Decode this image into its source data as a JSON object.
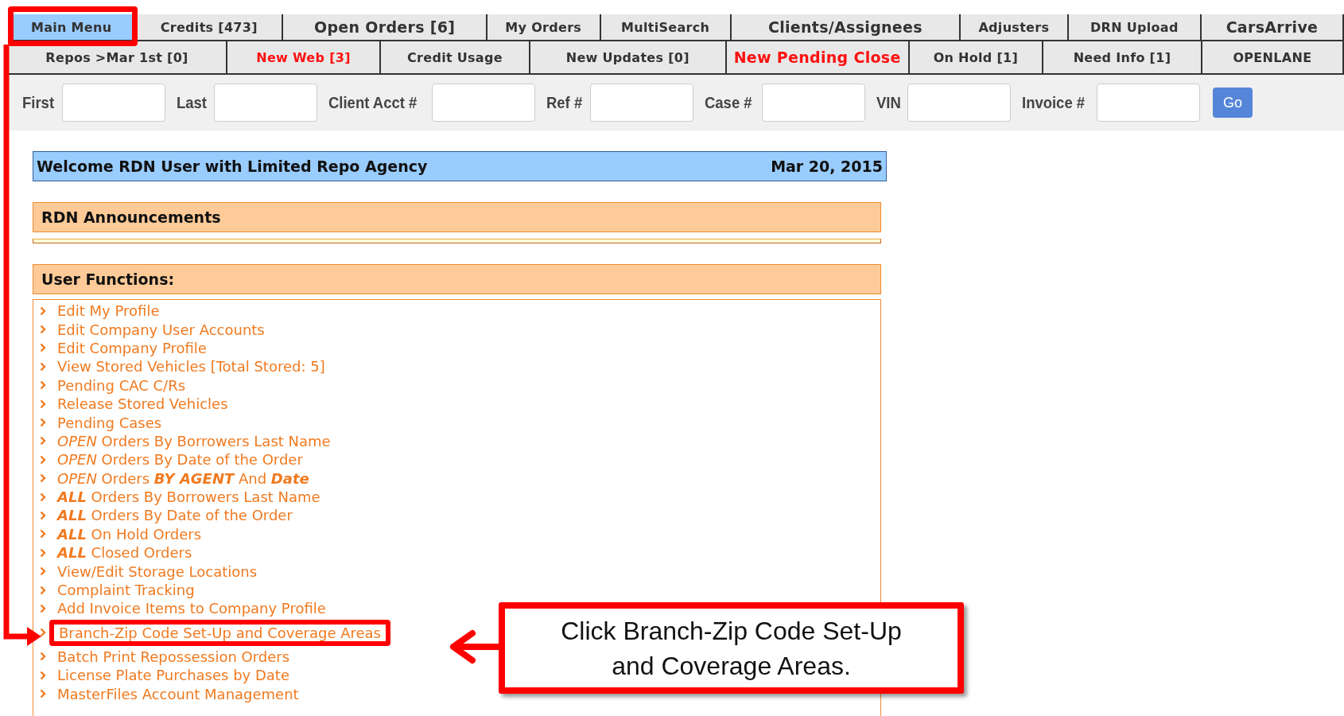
{
  "tabs_row_1": [
    {
      "label": "Main Menu",
      "selected": true,
      "alert": false,
      "large": false
    },
    {
      "label": "Credits [473]",
      "selected": false,
      "alert": false,
      "large": false
    },
    {
      "label": "Open Orders [6]",
      "selected": false,
      "alert": false,
      "large": true
    },
    {
      "label": "My Orders",
      "selected": false,
      "alert": false,
      "large": false
    },
    {
      "label": "MultiSearch",
      "selected": false,
      "alert": false,
      "large": false
    },
    {
      "label": "Clients/Assignees",
      "selected": false,
      "alert": false,
      "large": true
    },
    {
      "label": "Adjusters",
      "selected": false,
      "alert": false,
      "large": false
    },
    {
      "label": "DRN Upload",
      "selected": false,
      "alert": false,
      "large": false
    },
    {
      "label": "CarsArrive",
      "selected": false,
      "alert": false,
      "large": true
    }
  ],
  "tabs_row_2": [
    {
      "label": "Repos >Mar 1st [0]",
      "selected": false,
      "alert": false,
      "large": false
    },
    {
      "label": "New Web [3]",
      "selected": false,
      "alert": true,
      "large": false
    },
    {
      "label": "Credit Usage",
      "selected": false,
      "alert": false,
      "large": false
    },
    {
      "label": "New Updates [0]",
      "selected": false,
      "alert": false,
      "large": false
    },
    {
      "label": "New Pending Close",
      "selected": false,
      "alert": true,
      "large": true
    },
    {
      "label": "On Hold [1]",
      "selected": false,
      "alert": false,
      "large": false
    },
    {
      "label": "Need Info [1]",
      "selected": false,
      "alert": false,
      "large": false
    },
    {
      "label": "OPENLANE",
      "selected": false,
      "alert": false,
      "large": false
    }
  ],
  "search": {
    "fields": [
      "First",
      "Last",
      "Client Acct #",
      "Ref #",
      "Case #",
      "VIN",
      "Invoice #"
    ],
    "button": "Go"
  },
  "welcome": {
    "text": "Welcome RDN User with Limited Repo Agency",
    "date": "Mar 20, 2015"
  },
  "announcements": {
    "title": "RDN Announcements"
  },
  "user_functions": {
    "title": "User Functions:",
    "items": [
      {
        "text": "Edit My Profile",
        "highlighted": false
      },
      {
        "text": "Edit Company User Accounts",
        "highlighted": false
      },
      {
        "text": "Edit Company Profile",
        "highlighted": false
      },
      {
        "text": "View Stored Vehicles [Total Stored: 5]",
        "highlighted": false
      },
      {
        "text": "Pending CAC C/Rs",
        "highlighted": false
      },
      {
        "text": "Release Stored Vehicles",
        "highlighted": false
      },
      {
        "text": "Pending Cases",
        "highlighted": false
      },
      {
        "text": "*OPEN* Orders By Borrowers Last Name",
        "highlighted": false
      },
      {
        "text": "*OPEN* Orders By Date of the Order",
        "highlighted": false
      },
      {
        "text": "*OPEN* Orders **BY AGENT** And **Date**",
        "highlighted": false
      },
      {
        "text": "**ALL** Orders By Borrowers Last Name",
        "highlighted": false
      },
      {
        "text": "**ALL** Orders By Date of the Order",
        "highlighted": false
      },
      {
        "text": "**ALL** On Hold Orders",
        "highlighted": false
      },
      {
        "text": "**ALL** Closed Orders",
        "highlighted": false
      },
      {
        "text": "View/Edit Storage Locations",
        "highlighted": false
      },
      {
        "text": "Complaint Tracking",
        "highlighted": false
      },
      {
        "text": "Add Invoice Items to Company Profile",
        "highlighted": false
      },
      {
        "text": "Branch-Zip Code Set-Up and Coverage Areas",
        "highlighted": true
      },
      {
        "text": "Batch Print Repossession Orders",
        "highlighted": false
      },
      {
        "text": "License Plate Purchases by Date",
        "highlighted": false
      },
      {
        "text": "MasterFiles Account Management",
        "highlighted": false
      }
    ]
  },
  "annotation": {
    "callout": "Click Branch-Zip Code Set-Up and Coverage Areas."
  }
}
